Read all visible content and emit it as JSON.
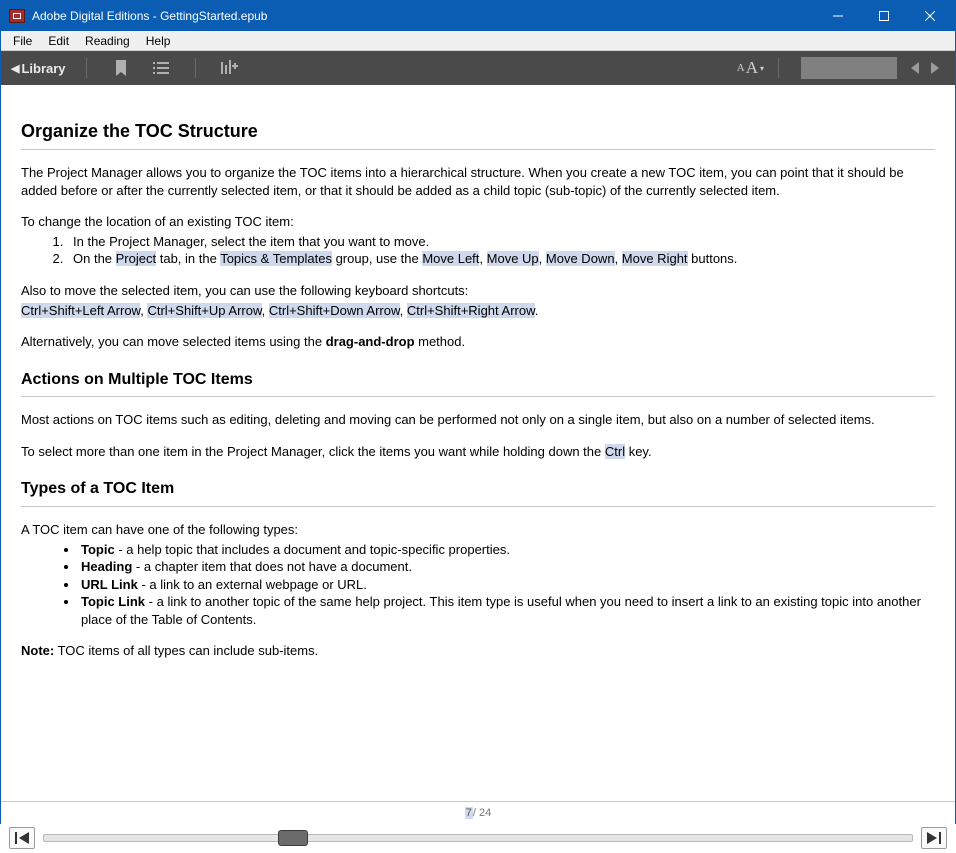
{
  "window": {
    "title": "Adobe Digital Editions - GettingStarted.epub"
  },
  "menubar": {
    "items": [
      "File",
      "Edit",
      "Reading",
      "Help"
    ]
  },
  "toolbar": {
    "library_label": "Library"
  },
  "status": {
    "current_page": "7",
    "total_pages_suffix": " / 24"
  },
  "doc": {
    "h_organize": "Organize the TOC Structure",
    "p_intro": "The Project Manager allows you to organize the TOC items into a hierarchical structure. When you create a new TOC item, you can point that it should be added before or after the currently selected item, or that it should be added as a child topic (sub-topic) of the currently selected item.",
    "p_change_loc": "To change the location of an existing TOC item:",
    "ol1_1": "In the Project Manager, select the item that you want to move.",
    "ol1_2a": "On the ",
    "ol1_2_project": "Project",
    "ol1_2b": " tab, in the ",
    "ol1_2_topics": "Topics & Templates",
    "ol1_2c": " group, use the ",
    "ol1_2_ml": "Move Left",
    "ol1_2d": ", ",
    "ol1_2_mu": "Move Up",
    "ol1_2e": ", ",
    "ol1_2_md": "Move Down",
    "ol1_2f": ", ",
    "ol1_2_mr": "Move Right",
    "ol1_2g": " buttons.",
    "p_kb1": "Also to move the selected item, you can use the following keyboard shortcuts:",
    "kb_a": "Ctrl+Shift+Left Arrow",
    "kb_s1": ", ",
    "kb_b": "Ctrl+Shift+Up Arrow",
    "kb_s2": ", ",
    "kb_c": "Ctrl+Shift+Down Arrow",
    "kb_s3": ", ",
    "kb_d": "Ctrl+Shift+Right Arrow",
    "kb_end": ".",
    "p_alt_a": "Alternatively, you can move selected items using the ",
    "p_alt_bold": "drag-and-drop",
    "p_alt_b": " method.",
    "h_actions": "Actions on Multiple TOC Items",
    "p_actions": "Most actions on TOC items such as editing, deleting and moving can be performed not only on a single item, but also on a number of selected items.",
    "p_select_a": "To select more than one item in the Project Manager, click the items you want while holding down the ",
    "p_select_ctrl": "Ctrl",
    "p_select_b": " key.",
    "h_types": "Types of a TOC Item",
    "p_types_intro": "A TOC item can have one of the following types:",
    "t1_b": "Topic",
    "t1_r": " - a help topic that includes a document and topic-specific properties.",
    "t2_b": "Heading",
    "t2_r": " - a chapter item that does not have a document.",
    "t3_b": "URL Link",
    "t3_r": " - a link to an external webpage or URL.",
    "t4_b": "Topic Link",
    "t4_r": " - a link to another topic of the same help project. This item type is useful when you need to insert a link to an existing topic into another place of the Table of Contents.",
    "note_b": "Note:",
    "note_r": " TOC items of all types can include sub-items."
  },
  "slider": {
    "thumb_left_percent": 27
  }
}
